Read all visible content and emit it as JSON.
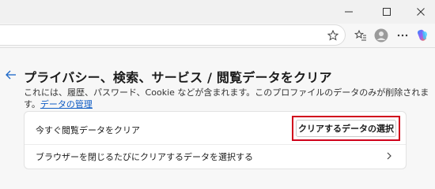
{
  "window": {
    "minimize_icon": "minimize-icon",
    "maximize_icon": "maximize-icon",
    "close_icon": "close-icon"
  },
  "toolbar": {
    "favorite_icon": "star-icon",
    "collections_icon": "favorites-list-icon",
    "profile_icon": "profile-avatar-icon",
    "more_icon": "more-options-icon",
    "copilot_icon": "copilot-icon"
  },
  "page": {
    "title": "プライバシー、検索、サービス / 閲覧データをクリア",
    "description": "これには、履歴、パスワード、Cookie などが含まれます。このプロファイルのデータのみが削除されま",
    "description_cont": "す。",
    "manage_link": "データの管理"
  },
  "card": {
    "row1_label": "今すぐ閲覧データをクリア",
    "select_button": "クリアするデータの選択",
    "row2_label": "ブラウザーを閉じるたびにクリアするデータを選択する"
  },
  "colors": {
    "highlight": "#d0021b",
    "link": "#0f5cc4",
    "accent": "#0f6cbd"
  }
}
